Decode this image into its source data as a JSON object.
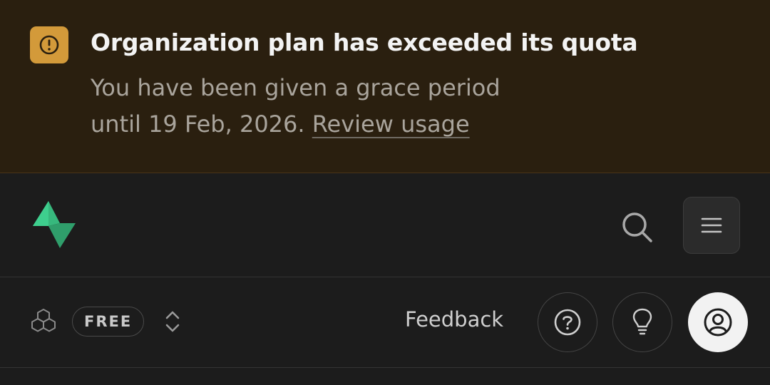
{
  "banner": {
    "icon": "alert-icon",
    "title": "Organization plan has exceeded its quota",
    "body_prefix": "You have been given a grace period until 19 Feb, 2026.",
    "link_label": "Review usage",
    "accent_color": "#d39a3a"
  },
  "topbar": {
    "logo": "supabase-logo",
    "search_icon": "search-icon",
    "menu_icon": "menu-icon"
  },
  "subbar": {
    "org_icon": "cubes-icon",
    "plan_badge": "FREE",
    "switcher_icon": "chevron-up-down-icon",
    "feedback_label": "Feedback",
    "buttons": [
      "help-icon",
      "lightbulb-icon",
      "user-icon"
    ]
  }
}
